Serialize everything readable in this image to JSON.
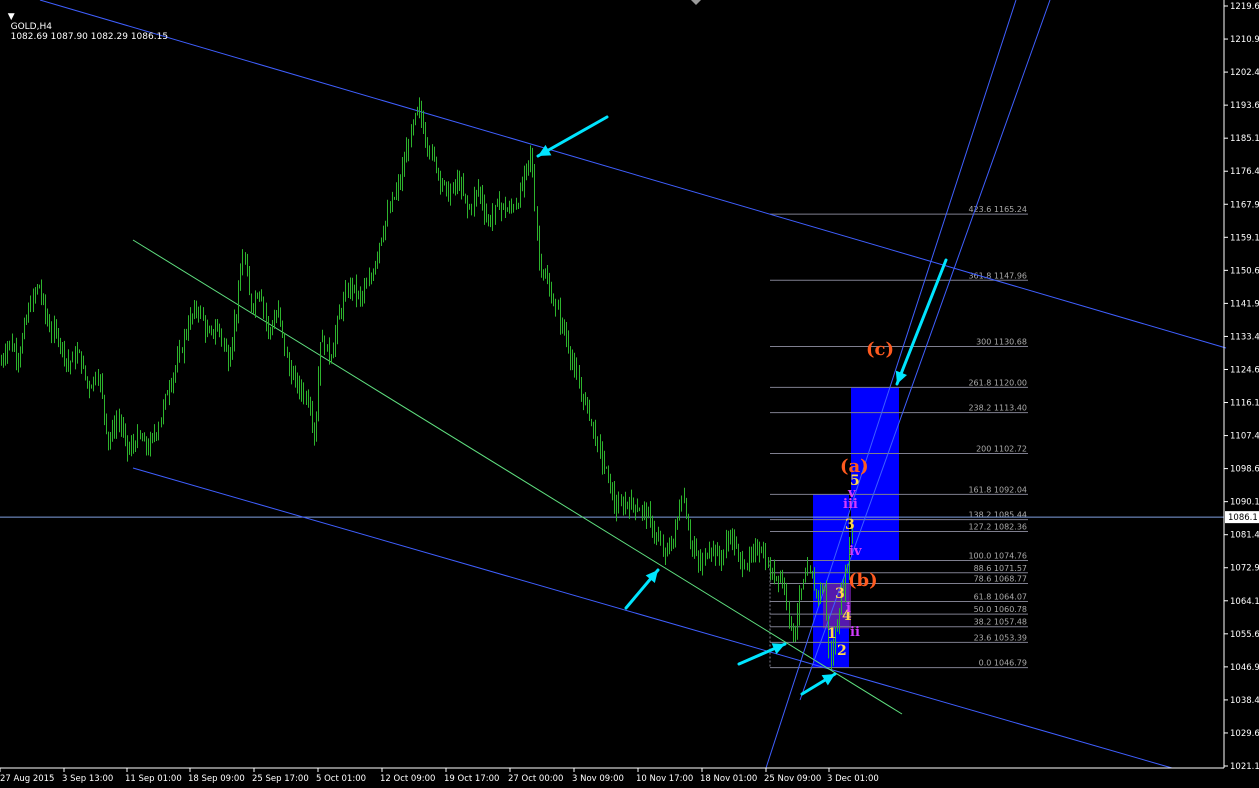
{
  "header": {
    "symbol": "GOLD,H4",
    "ohlc": "1082.69 1087.90 1082.29 1086.15",
    "menu_glyph": "▼"
  },
  "colors": {
    "background": "#000000",
    "candle": "#2db32d",
    "axis_text": "#ffffff",
    "channel": "#3f5fff",
    "trendline": "#5fdf7f",
    "fib": "#7f7f8f",
    "fib_text": "#a9a9a9",
    "arrow": "#00e5ff",
    "box": "#0000ff",
    "price_line": "#7f9fdf",
    "orange_label": "#ff5a1f",
    "yellow_label": "#ffd84a",
    "magenta_label": "#d43cff",
    "current_price_box": "#ffffff"
  },
  "chart_data": {
    "type": "candlestick",
    "title": "GOLD,H4",
    "ylim": [
      1021.1,
      1219.6
    ],
    "y_ticks": [
      "1219.6",
      "1210.9",
      "1202.4",
      "1193.6",
      "1185.1",
      "1176.4",
      "1167.9",
      "1159.1",
      "1150.6",
      "1141.9",
      "1133.4",
      "1124.6",
      "1116.1",
      "1107.4",
      "1098.6",
      "1090.1",
      "1081.4",
      "1072.9",
      "1064.1",
      "1055.6",
      "1046.9",
      "1038.4",
      "1029.6",
      "1021.1"
    ],
    "x_ticks": [
      "27 Aug 2015",
      "3 Sep 13:00",
      "11 Sep 01:00",
      "18 Sep 09:00",
      "25 Sep 17:00",
      "5 Oct 01:00",
      "12 Oct 09:00",
      "19 Oct 17:00",
      "27 Oct 00:00",
      "3 Nov 09:00",
      "10 Nov 17:00",
      "18 Nov 01:00",
      "25 Nov 09:00",
      "3 Dec 01:00"
    ],
    "current_price": "1086.1",
    "price_path": [
      [
        0,
        1126
      ],
      [
        8,
        1132
      ],
      [
        18,
        1128
      ],
      [
        28,
        1140
      ],
      [
        38,
        1147
      ],
      [
        48,
        1136
      ],
      [
        58,
        1133
      ],
      [
        68,
        1126
      ],
      [
        78,
        1129
      ],
      [
        88,
        1120
      ],
      [
        98,
        1124
      ],
      [
        108,
        1106
      ],
      [
        118,
        1112
      ],
      [
        128,
        1103
      ],
      [
        138,
        1107
      ],
      [
        148,
        1104
      ],
      [
        158,
        1110
      ],
      [
        168,
        1120
      ],
      [
        178,
        1127
      ],
      [
        188,
        1137
      ],
      [
        198,
        1141
      ],
      [
        208,
        1133
      ],
      [
        218,
        1136
      ],
      [
        228,
        1127
      ],
      [
        238,
        1143
      ],
      [
        243,
        1156
      ],
      [
        250,
        1141
      ],
      [
        260,
        1146
      ],
      [
        268,
        1134
      ],
      [
        278,
        1140
      ],
      [
        288,
        1125
      ],
      [
        298,
        1120
      ],
      [
        308,
        1117
      ],
      [
        315,
        1107
      ],
      [
        320,
        1133
      ],
      [
        330,
        1128
      ],
      [
        340,
        1140
      ],
      [
        350,
        1147
      ],
      [
        360,
        1143
      ],
      [
        370,
        1148
      ],
      [
        380,
        1159
      ],
      [
        390,
        1167
      ],
      [
        400,
        1174
      ],
      [
        410,
        1186
      ],
      [
        418,
        1193
      ],
      [
        428,
        1183
      ],
      [
        438,
        1176
      ],
      [
        448,
        1170
      ],
      [
        458,
        1174
      ],
      [
        468,
        1166
      ],
      [
        478,
        1172
      ],
      [
        488,
        1163
      ],
      [
        498,
        1168
      ],
      [
        508,
        1166
      ],
      [
        518,
        1169
      ],
      [
        525,
        1176
      ],
      [
        531,
        1181
      ],
      [
        538,
        1154
      ],
      [
        548,
        1146
      ],
      [
        558,
        1139
      ],
      [
        568,
        1131
      ],
      [
        578,
        1120
      ],
      [
        588,
        1114
      ],
      [
        598,
        1104
      ],
      [
        608,
        1096
      ],
      [
        616,
        1088
      ],
      [
        626,
        1090
      ],
      [
        636,
        1089
      ],
      [
        646,
        1087
      ],
      [
        656,
        1081
      ],
      [
        664,
        1076
      ],
      [
        674,
        1081
      ],
      [
        682,
        1093
      ],
      [
        690,
        1080
      ],
      [
        700,
        1073
      ],
      [
        710,
        1079
      ],
      [
        720,
        1075
      ],
      [
        730,
        1082
      ],
      [
        740,
        1074
      ],
      [
        750,
        1075
      ],
      [
        760,
        1079
      ],
      [
        770,
        1071
      ],
      [
        780,
        1071
      ],
      [
        786,
        1066
      ],
      [
        792,
        1054
      ],
      [
        800,
        1066
      ],
      [
        808,
        1072
      ],
      [
        816,
        1066
      ],
      [
        824,
        1068
      ],
      [
        830,
        1047
      ],
      [
        836,
        1058
      ],
      [
        840,
        1064
      ],
      [
        848,
        1075
      ],
      [
        852,
        1086
      ]
    ],
    "fib_levels": [
      {
        "label": "423.6  1165.24",
        "price": 1165.24
      },
      {
        "label": "361.8  1147.96",
        "price": 1147.96
      },
      {
        "label": "300  1130.68",
        "price": 1130.68
      },
      {
        "label": "261.8  1120.00",
        "price": 1120.0
      },
      {
        "label": "238.2  1113.40",
        "price": 1113.4
      },
      {
        "label": "200  1102.72",
        "price": 1102.72
      },
      {
        "label": "161.8  1092.04",
        "price": 1092.04
      },
      {
        "label": "138.2  1085.44",
        "price": 1085.44
      },
      {
        "label": "127.2  1082.36",
        "price": 1082.36
      },
      {
        "label": "100.0  1074.76",
        "price": 1074.76
      },
      {
        "label": "88.6  1071.57",
        "price": 1071.57
      },
      {
        "label": "78.6  1068.77",
        "price": 1068.77
      },
      {
        "label": "61.8  1064.07",
        "price": 1064.07
      },
      {
        "label": "50.0  1060.78",
        "price": 1060.78
      },
      {
        "label": "38.2  1057.48",
        "price": 1057.48
      },
      {
        "label": "23.6  1053.39",
        "price": 1053.39
      },
      {
        "label": "0.0  1046.79",
        "price": 1046.79
      }
    ],
    "wave_labels": [
      {
        "text": "(c)",
        "color": "orange",
        "size": 18
      },
      {
        "text": "(a)",
        "color": "orange",
        "size": 18
      },
      {
        "text": "(b)",
        "color": "orange",
        "size": 18
      },
      {
        "text": "5",
        "color": "yellow",
        "size": 14
      },
      {
        "text": "v",
        "color": "magenta",
        "size": 13
      },
      {
        "text": "iii",
        "color": "magenta",
        "size": 13
      },
      {
        "text": "3",
        "color": "yellow",
        "size": 14
      },
      {
        "text": "iv",
        "color": "magenta",
        "size": 13
      },
      {
        "text": "3",
        "color": "yellow",
        "size": 14
      },
      {
        "text": "1",
        "color": "yellow",
        "size": 14
      },
      {
        "text": "4",
        "color": "yellow",
        "size": 14
      },
      {
        "text": "ii",
        "color": "magenta",
        "size": 13
      },
      {
        "text": "i",
        "color": "magenta",
        "size": 13
      },
      {
        "text": "2",
        "color": "yellow",
        "size": 14
      }
    ]
  }
}
